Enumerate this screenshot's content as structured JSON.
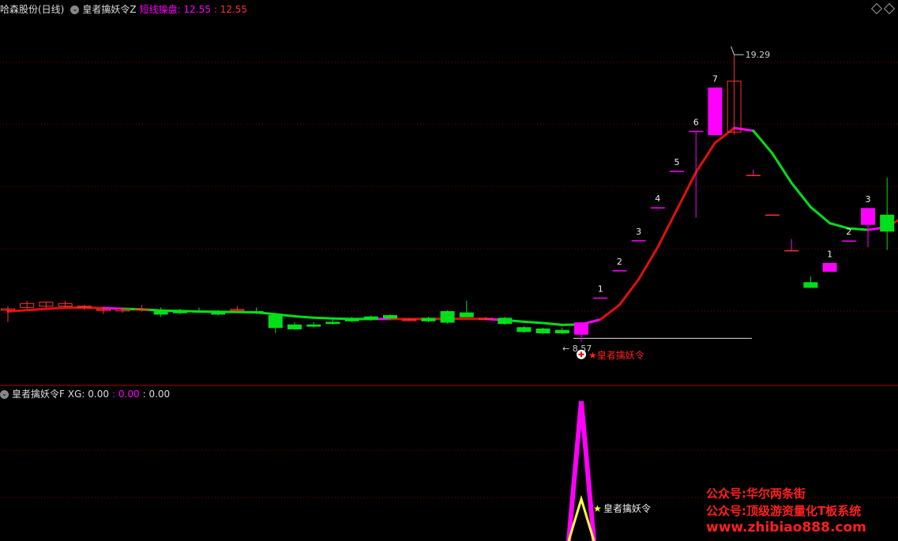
{
  "header": {
    "stock_name": "哈森股份(日线)",
    "indicator": "皇者擒妖令Z",
    "series_label": "短线操盘",
    "value1": ": 12.55",
    "value2": ": 12.55"
  },
  "sub_header": {
    "indicator": "皇者擒妖令F",
    "xg_label": "XG: 0.00",
    "v2": ": 0.00",
    "v3": ": 0.00"
  },
  "icons": {
    "collapse": "chevron-down-icon",
    "layout": "diamond-icon",
    "buy_signal": "plus-circle-icon"
  },
  "colors": {
    "up": "#ff3232",
    "down": "#00e01a",
    "magenta": "#ff00ff",
    "yellow": "#ffff40",
    "red_line": "#e01010",
    "watermark": "#ff2020"
  },
  "watermark": {
    "line1": "公众号:华尔两条街",
    "line2": "公众号:顶级游资量化T板系统",
    "line3": "www.zhibiao888.com"
  },
  "chart_data": [
    {
      "type": "candlestick",
      "title": "哈森股份(日线)",
      "annotations": {
        "high_label": "19.29",
        "low_label": "8.57",
        "signal_label": "★皇者擒妖令",
        "limit_up_counts": [
          "1",
          "2",
          "3",
          "4",
          "5",
          "6",
          "7"
        ],
        "later_counts": [
          "1",
          "2",
          "3",
          "1"
        ]
      },
      "ylim": [
        7.0,
        20.8
      ],
      "grid": "dotted-horizontal",
      "candles": [
        {
          "o": 9.8,
          "h": 9.9,
          "l": 9.3,
          "c": 9.75,
          "color": "up"
        },
        {
          "o": 9.85,
          "h": 10.1,
          "l": 9.8,
          "c": 10.0,
          "color": "up"
        },
        {
          "o": 9.9,
          "h": 10.05,
          "l": 9.85,
          "c": 10.05,
          "color": "up"
        },
        {
          "o": 9.9,
          "h": 10.1,
          "l": 9.85,
          "c": 10.0,
          "color": "up"
        },
        {
          "o": 9.85,
          "h": 9.95,
          "l": 9.75,
          "c": 9.9,
          "color": "up"
        },
        {
          "o": 9.75,
          "h": 9.85,
          "l": 9.6,
          "c": 9.78,
          "color": "up"
        },
        {
          "o": 9.72,
          "h": 9.85,
          "l": 9.65,
          "c": 9.8,
          "color": "up"
        },
        {
          "o": 9.78,
          "h": 9.95,
          "l": 9.7,
          "c": 9.8,
          "color": "up"
        },
        {
          "o": 9.75,
          "h": 9.85,
          "l": 9.5,
          "c": 9.6,
          "color": "down"
        },
        {
          "o": 9.7,
          "h": 9.8,
          "l": 9.6,
          "c": 9.65,
          "color": "down"
        },
        {
          "o": 9.7,
          "h": 9.85,
          "l": 9.65,
          "c": 9.72,
          "color": "down"
        },
        {
          "o": 9.7,
          "h": 9.75,
          "l": 9.55,
          "c": 9.6,
          "color": "down"
        },
        {
          "o": 9.75,
          "h": 9.9,
          "l": 9.65,
          "c": 9.78,
          "color": "up"
        },
        {
          "o": 9.7,
          "h": 9.85,
          "l": 9.6,
          "c": 9.68,
          "color": "down"
        },
        {
          "o": 9.55,
          "h": 9.6,
          "l": 8.9,
          "c": 9.1,
          "color": "down"
        },
        {
          "o": 9.2,
          "h": 9.3,
          "l": 9.0,
          "c": 9.05,
          "color": "down"
        },
        {
          "o": 9.2,
          "h": 9.3,
          "l": 9.1,
          "c": 9.15,
          "color": "down"
        },
        {
          "o": 9.3,
          "h": 9.4,
          "l": 9.2,
          "c": 9.25,
          "color": "down"
        },
        {
          "o": 9.4,
          "h": 9.5,
          "l": 9.3,
          "c": 9.35,
          "color": "down"
        },
        {
          "o": 9.5,
          "h": 9.55,
          "l": 9.35,
          "c": 9.4,
          "color": "down"
        },
        {
          "o": 9.55,
          "h": 9.6,
          "l": 9.4,
          "c": 9.45,
          "color": "down"
        },
        {
          "o": 9.4,
          "h": 9.45,
          "l": 9.35,
          "c": 9.4,
          "color": "up"
        },
        {
          "o": 9.45,
          "h": 9.5,
          "l": 9.3,
          "c": 9.35,
          "color": "down"
        },
        {
          "o": 9.7,
          "h": 9.75,
          "l": 9.25,
          "c": 9.3,
          "color": "down"
        },
        {
          "o": 9.65,
          "h": 10.1,
          "l": 9.5,
          "c": 9.5,
          "color": "down"
        },
        {
          "o": 9.45,
          "h": 9.5,
          "l": 9.4,
          "c": 9.45,
          "color": "up"
        },
        {
          "o": 9.45,
          "h": 9.5,
          "l": 9.2,
          "c": 9.25,
          "color": "down"
        },
        {
          "o": 9.1,
          "h": 9.15,
          "l": 8.9,
          "c": 8.95,
          "color": "down"
        },
        {
          "o": 9.05,
          "h": 9.1,
          "l": 8.85,
          "c": 8.9,
          "color": "down"
        },
        {
          "o": 9.0,
          "h": 9.1,
          "l": 8.85,
          "c": 8.9,
          "color": "down"
        },
        {
          "o": 8.85,
          "h": 9.28,
          "l": 8.57,
          "c": 9.28,
          "color": "limit"
        },
        {
          "o": 10.2,
          "h": 10.2,
          "l": 10.2,
          "c": 10.2,
          "color": "limit_t"
        },
        {
          "o": 11.22,
          "h": 11.22,
          "l": 11.22,
          "c": 11.22,
          "color": "limit_t"
        },
        {
          "o": 12.34,
          "h": 12.34,
          "l": 12.34,
          "c": 12.34,
          "color": "limit_t"
        },
        {
          "o": 13.57,
          "h": 13.57,
          "l": 13.57,
          "c": 13.57,
          "color": "limit_t"
        },
        {
          "o": 14.93,
          "h": 14.93,
          "l": 14.93,
          "c": 14.93,
          "color": "limit_t"
        },
        {
          "o": 16.42,
          "h": 16.42,
          "l": 13.2,
          "c": 16.42,
          "color": "limit_t"
        },
        {
          "o": 16.3,
          "h": 18.05,
          "l": 16.3,
          "c": 18.05,
          "color": "limit"
        },
        {
          "o": 18.3,
          "h": 19.29,
          "l": 16.3,
          "c": 16.4,
          "color": "up_hollow"
        },
        {
          "o": 14.78,
          "h": 15.0,
          "l": 14.78,
          "c": 14.78,
          "color": "limit_t_down"
        },
        {
          "o": 13.3,
          "h": 13.3,
          "l": 13.3,
          "c": 13.3,
          "color": "limit_t_down"
        },
        {
          "o": 11.97,
          "h": 12.4,
          "l": 11.97,
          "c": 11.97,
          "color": "limit_t_down"
        },
        {
          "o": 10.6,
          "h": 11.0,
          "l": 10.6,
          "c": 10.78,
          "color": "down"
        },
        {
          "o": 11.5,
          "h": 11.5,
          "l": 11.2,
          "c": 11.2,
          "color": "limit"
        },
        {
          "o": 12.33,
          "h": 12.33,
          "l": 12.33,
          "c": 12.33,
          "color": "limit_t"
        },
        {
          "o": 13.55,
          "h": 13.55,
          "l": 12.1,
          "c": 12.95,
          "color": "limit"
        },
        {
          "o": 13.3,
          "h": 14.7,
          "l": 12.0,
          "c": 12.7,
          "color": "down"
        },
        {
          "o": 13.7,
          "h": 13.7,
          "l": 11.6,
          "c": 11.6,
          "color": "limit"
        }
      ],
      "ma_line": [
        {
          "v": 9.7,
          "c": "red"
        },
        {
          "v": 9.75,
          "c": "red"
        },
        {
          "v": 9.8,
          "c": "red"
        },
        {
          "v": 9.84,
          "c": "red"
        },
        {
          "v": 9.85,
          "c": "red"
        },
        {
          "v": 9.83,
          "c": "red"
        },
        {
          "v": 9.8,
          "c": "magenta"
        },
        {
          "v": 9.78,
          "c": "green"
        },
        {
          "v": 9.74,
          "c": "green"
        },
        {
          "v": 9.72,
          "c": "green"
        },
        {
          "v": 9.7,
          "c": "green"
        },
        {
          "v": 9.69,
          "c": "green"
        },
        {
          "v": 9.68,
          "c": "green"
        },
        {
          "v": 9.67,
          "c": "green"
        },
        {
          "v": 9.6,
          "c": "green"
        },
        {
          "v": 9.52,
          "c": "green"
        },
        {
          "v": 9.47,
          "c": "green"
        },
        {
          "v": 9.44,
          "c": "green"
        },
        {
          "v": 9.42,
          "c": "green"
        },
        {
          "v": 9.42,
          "c": "green"
        },
        {
          "v": 9.42,
          "c": "magenta"
        },
        {
          "v": 9.42,
          "c": "red"
        },
        {
          "v": 9.42,
          "c": "red"
        },
        {
          "v": 9.43,
          "c": "red"
        },
        {
          "v": 9.43,
          "c": "red"
        },
        {
          "v": 9.42,
          "c": "red"
        },
        {
          "v": 9.38,
          "c": "magenta"
        },
        {
          "v": 9.32,
          "c": "green"
        },
        {
          "v": 9.27,
          "c": "green"
        },
        {
          "v": 9.2,
          "c": "green"
        },
        {
          "v": 9.22,
          "c": "green"
        },
        {
          "v": 9.4,
          "c": "magenta"
        },
        {
          "v": 9.95,
          "c": "red"
        },
        {
          "v": 10.9,
          "c": "red"
        },
        {
          "v": 12.1,
          "c": "red"
        },
        {
          "v": 13.5,
          "c": "red"
        },
        {
          "v": 14.9,
          "c": "red"
        },
        {
          "v": 16.0,
          "c": "red"
        },
        {
          "v": 16.55,
          "c": "red"
        },
        {
          "v": 16.45,
          "c": "magenta"
        },
        {
          "v": 15.6,
          "c": "green"
        },
        {
          "v": 14.5,
          "c": "green"
        },
        {
          "v": 13.6,
          "c": "green"
        },
        {
          "v": 13.0,
          "c": "green"
        },
        {
          "v": 12.8,
          "c": "green"
        },
        {
          "v": 12.75,
          "c": "green"
        },
        {
          "v": 12.85,
          "c": "magenta"
        },
        {
          "v": 13.3,
          "c": "red"
        }
      ]
    },
    {
      "type": "line",
      "title": "皇者擒妖令F",
      "annotations": {
        "signal_label": "皇者擒妖令"
      },
      "series": [
        {
          "name": "XG",
          "values": [
            0,
            0,
            0,
            0,
            0,
            0,
            0,
            0,
            0,
            0,
            0,
            0,
            0,
            0,
            0,
            0,
            0,
            0,
            0,
            0,
            0,
            0,
            0,
            0,
            0,
            0,
            0,
            0,
            0,
            0,
            1,
            0,
            0,
            0,
            0,
            0,
            0,
            0,
            0,
            0,
            0,
            0,
            0,
            0,
            0,
            0,
            0,
            0
          ],
          "color": "magenta"
        },
        {
          "name": "",
          "values": [
            0,
            0,
            0,
            0,
            0,
            0,
            0,
            0,
            0,
            0,
            0,
            0,
            0,
            0,
            0,
            0,
            0,
            0,
            0,
            0,
            0,
            0,
            0,
            0,
            0,
            0,
            0,
            0,
            0,
            0,
            0.3,
            0,
            0,
            0,
            0,
            0,
            0,
            0,
            0,
            0,
            0,
            0,
            0,
            0,
            0,
            0,
            0,
            0
          ],
          "color": "yellow"
        }
      ],
      "ylim": [
        0,
        1
      ]
    }
  ]
}
